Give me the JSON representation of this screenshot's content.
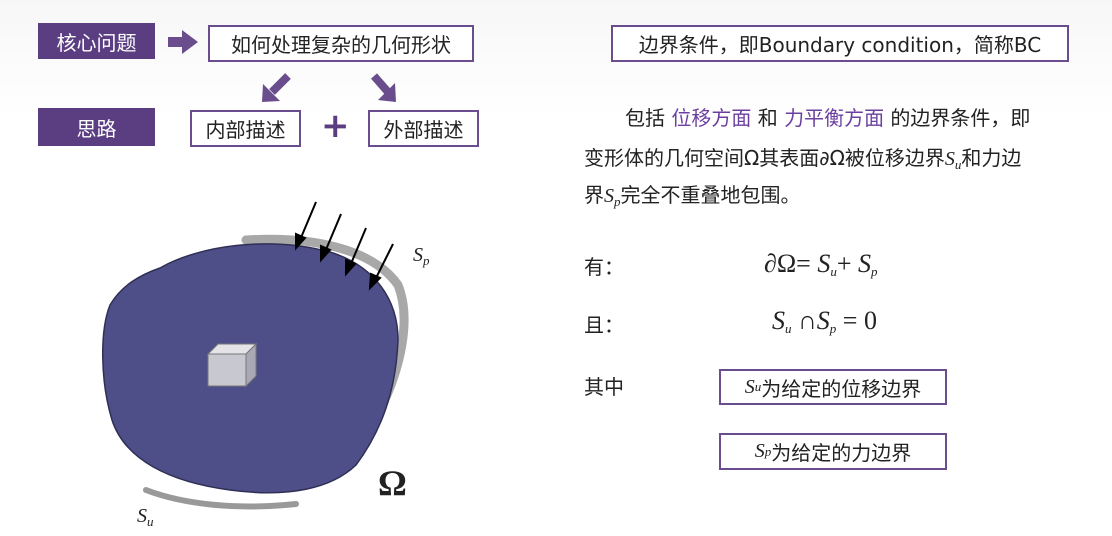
{
  "header": {
    "core_tag": "核心问题",
    "core_question": "如何处理复杂的几何形状",
    "approach_tag": "思路",
    "internal": "内部描述",
    "plus": "+",
    "external": "外部描述"
  },
  "bc_title": "边界条件，即Boundary condition，简称BC",
  "paragraph": {
    "part1": "包括 ",
    "hl1": "位移方面",
    "part2": " 和 ",
    "hl2": "力平衡方面",
    "part3": " 的边界条件，即",
    "line2a": "变形体的几何空间Ω其表面∂Ω被位移边界",
    "su_S": "S",
    "su_sub": "u",
    "line2b": "和力边",
    "line3a": "界",
    "sp_S": "S",
    "sp_sub": "p",
    "line3b": "完全不重叠地包围。"
  },
  "eq1": {
    "label": "有：",
    "lhs": "∂Ω= ",
    "s1": "S",
    "s1sub": "u",
    "op": "+ ",
    "s2": "S",
    "s2sub": "p"
  },
  "eq2": {
    "label": "且：",
    "s1": "S",
    "s1sub": "u",
    "op": " ∩",
    "s2": "S",
    "s2sub": "p",
    "rhs": " = 0"
  },
  "where": {
    "label": "其中",
    "box1_S": "S",
    "box1_sub": "u",
    "box1_text": "为给定的位移边界",
    "box2_S": "S",
    "box2_sub": "p",
    "box2_text": "为给定的力边界"
  },
  "figure": {
    "omega": "Ω",
    "sp_label_S": "S",
    "sp_label_sub": "p",
    "su_label_S": "S",
    "su_label_sub": "u"
  },
  "colors": {
    "accent": "#5b3d82",
    "body_fill": "#4e4f88",
    "highlight": "#6b3fa0"
  }
}
